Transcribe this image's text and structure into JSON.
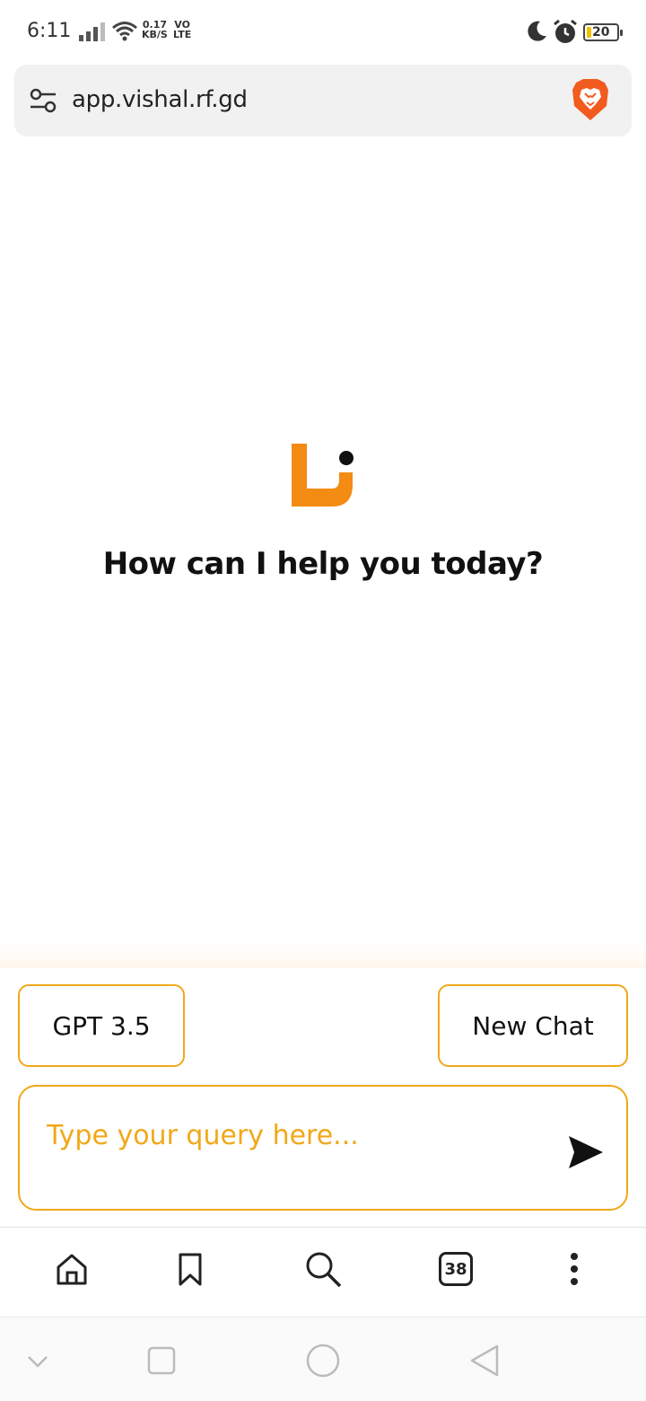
{
  "status_bar": {
    "time": "6:11",
    "speed_value": "0.17",
    "speed_unit": "KB/S",
    "network_top": "VO",
    "network_bottom": "LTE",
    "battery": "20"
  },
  "address_bar": {
    "url": "app.vishal.rf.gd"
  },
  "main": {
    "greeting": "How can I help you today?"
  },
  "composer": {
    "model_label": "GPT 3.5",
    "new_chat_label": "New Chat",
    "query_placeholder": "Type your query here...",
    "query_value": ""
  },
  "toolbar": {
    "tabs_count": "38"
  },
  "colors": {
    "accent": "#f0a81a",
    "logo": "#f48b12"
  }
}
